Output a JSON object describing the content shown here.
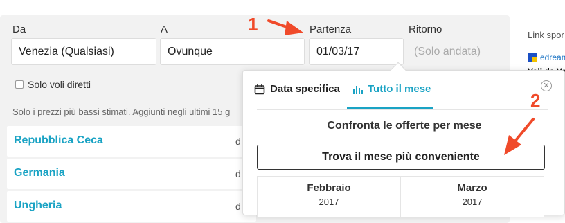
{
  "search": {
    "origin_label": "Da",
    "origin_value": "Venezia (Qualsiasi)",
    "destination_label": "A",
    "destination_value": "Ovunque",
    "departure_label": "Partenza",
    "departure_value": "01/03/17",
    "return_label": "Ritorno",
    "return_placeholder": "(Solo andata)",
    "direct_flights_label": "Solo voli diretti",
    "direct_flights_checked": false
  },
  "info_text": "Solo i prezzi più bassi stimati. Aggiunti negli ultimi 15 g",
  "results": [
    {
      "name": "Repubblica Ceca",
      "trailing": "d"
    },
    {
      "name": "Germania",
      "trailing": "d"
    },
    {
      "name": "Ungheria",
      "trailing": "d"
    }
  ],
  "sidebar": {
    "title": "Link spor",
    "brand": "edream",
    "link": "Voli da Ve"
  },
  "popup": {
    "tab_specific": "Data specifica",
    "tab_month": "Tutto il mese",
    "active_tab": "Tutto il mese",
    "title": "Confronta le offerte per mese",
    "cheapest_button": "Trova il mese più conveniente",
    "months": [
      {
        "name": "Febbraio",
        "year": "2017"
      },
      {
        "name": "Marzo",
        "year": "2017"
      }
    ]
  },
  "annotations": {
    "step1": "1",
    "step2": "2"
  },
  "colors": {
    "accent": "#1aa3c4",
    "annotation": "#f04a2a",
    "panel_bg": "#f2f2f2"
  }
}
